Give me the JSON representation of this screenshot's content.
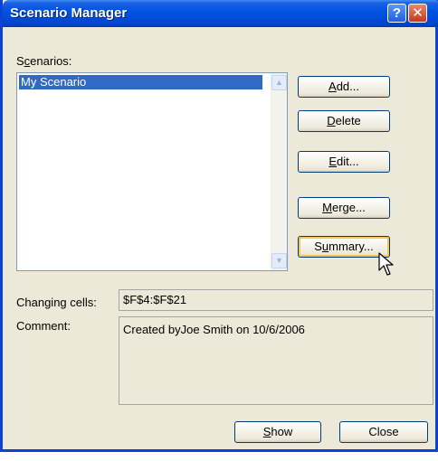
{
  "window": {
    "title": "Scenario Manager",
    "help_glyph": "?",
    "close_glyph": "✕"
  },
  "scenarios": {
    "label": "Scenarios:",
    "accel": "c",
    "items": [
      "My Scenario"
    ],
    "selected_index": 0
  },
  "buttons": {
    "add": {
      "pre": "",
      "acc": "A",
      "post": "dd..."
    },
    "delete": {
      "pre": "",
      "acc": "D",
      "post": "elete"
    },
    "edit": {
      "pre": "",
      "acc": "E",
      "post": "dit..."
    },
    "merge": {
      "pre": "",
      "acc": "M",
      "post": "erge..."
    },
    "summary": {
      "pre": "S",
      "acc": "u",
      "post": "mmary..."
    },
    "show": {
      "pre": "",
      "acc": "S",
      "post": "how"
    },
    "close": {
      "pre": "",
      "acc": "",
      "post": "Close"
    }
  },
  "changing_cells": {
    "label": "Changing cells:",
    "value": "$F$4:$F$21"
  },
  "comment": {
    "label": "Comment:",
    "value": "Created byJoe Smith on 10/6/2006"
  },
  "colors": {
    "titlebar": "#0054e3",
    "selection": "#316ac5",
    "dialog_bg": "#ece9d8"
  }
}
